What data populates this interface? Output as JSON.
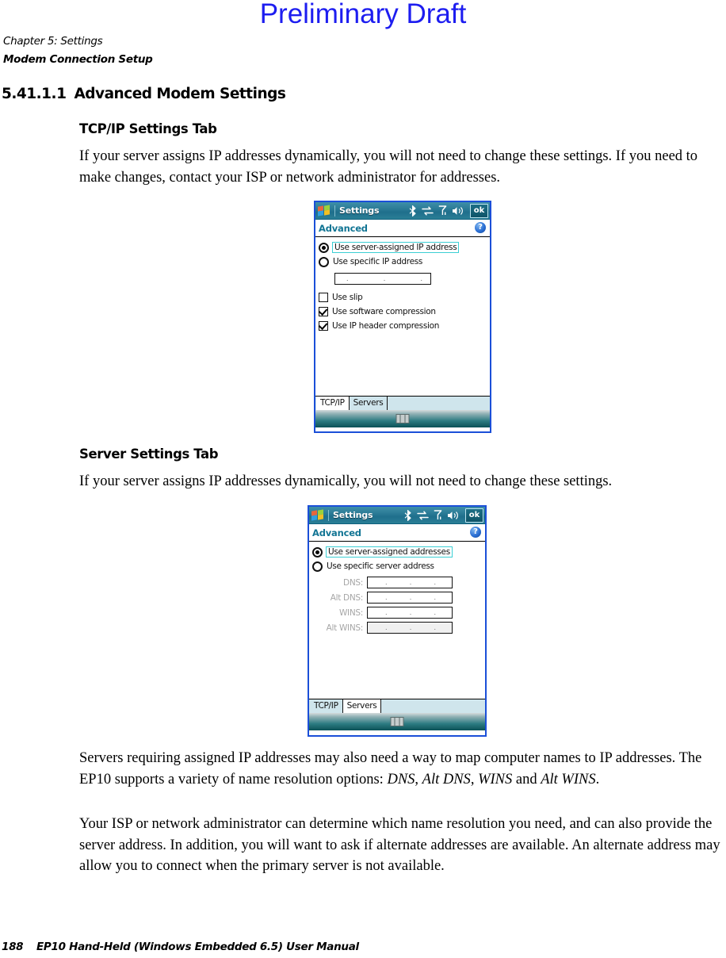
{
  "watermark": "Preliminary Draft",
  "running_header": {
    "line1": "Chapter 5:  Settings",
    "line2": "Modem Connection Setup"
  },
  "section": {
    "number": "5.41.1.1",
    "title": "Advanced Modem Settings"
  },
  "subheads": {
    "tcpip": "TCP/IP Settings Tab",
    "servers": "Server Settings Tab"
  },
  "paragraphs": {
    "p1": "If your server assigns IP addresses dynamically, you will not need to change these settings. If you need to make changes, contact your ISP or network administrator for addresses.",
    "p2": "If your server assigns IP addresses dynamically, you will not need to change these settings.",
    "p3_a": "Servers requiring assigned IP addresses may also need a way to map computer names to IP addresses. The EP10 supports a variety of name resolution options: ",
    "p3_i1": "DNS",
    "p3_b": ", ",
    "p3_i2": "Alt DNS",
    "p3_c": ", ",
    "p3_i3": "WINS",
    "p3_d": " and ",
    "p3_i4": "Alt WINS",
    "p3_e": ".",
    "p4": "Your ISP or network administrator can determine which name resolution you need, and can also provide the server address. In addition, you will want to ask if alternate addresses are available. An alternate address may allow you to connect when the primary server is not available."
  },
  "footer": {
    "page_number": "188",
    "manual_title": "EP10 Hand-Held (Windows Embedded 6.5) User Manual"
  },
  "device_tcpip": {
    "title": "Settings",
    "subtitle": "Advanced",
    "ok_label": "ok",
    "help_label": "?",
    "tray_icons": [
      "bluetooth-icon",
      "connectivity-icon",
      "signal-icon",
      "volume-icon"
    ],
    "controls": {
      "radio_server_assigned": "Use server-assigned IP address",
      "radio_specific": "Use specific IP address",
      "ip_value": "",
      "check_slip": "Use slip",
      "check_software_compression": "Use software compression",
      "check_ip_header_compression": "Use IP header compression"
    },
    "tabs": [
      {
        "label": "TCP/IP",
        "active": true
      },
      {
        "label": "Servers",
        "active": false
      }
    ]
  },
  "device_servers": {
    "title": "Settings",
    "subtitle": "Advanced",
    "ok_label": "ok",
    "help_label": "?",
    "tray_icons": [
      "bluetooth-icon",
      "connectivity-icon",
      "signal-icon",
      "volume-icon"
    ],
    "controls": {
      "radio_server_assigned": "Use server-assigned addresses",
      "radio_specific": "Use specific server address",
      "fields": [
        {
          "label": "DNS:",
          "value": ""
        },
        {
          "label": "Alt DNS:",
          "value": ""
        },
        {
          "label": "WINS:",
          "value": ""
        },
        {
          "label": "Alt WINS:",
          "value": ""
        }
      ]
    },
    "tabs": [
      {
        "label": "TCP/IP",
        "active": false
      },
      {
        "label": "Servers",
        "active": true
      }
    ]
  },
  "colors": {
    "watermark": "#1d1df0",
    "device_border": "#1b4fd8",
    "titlebar_teal": "#2f7f9a",
    "subtitle_text": "#127594",
    "focus_outline": "#3ccfd4",
    "tab_strip": "#cfe5ec"
  }
}
